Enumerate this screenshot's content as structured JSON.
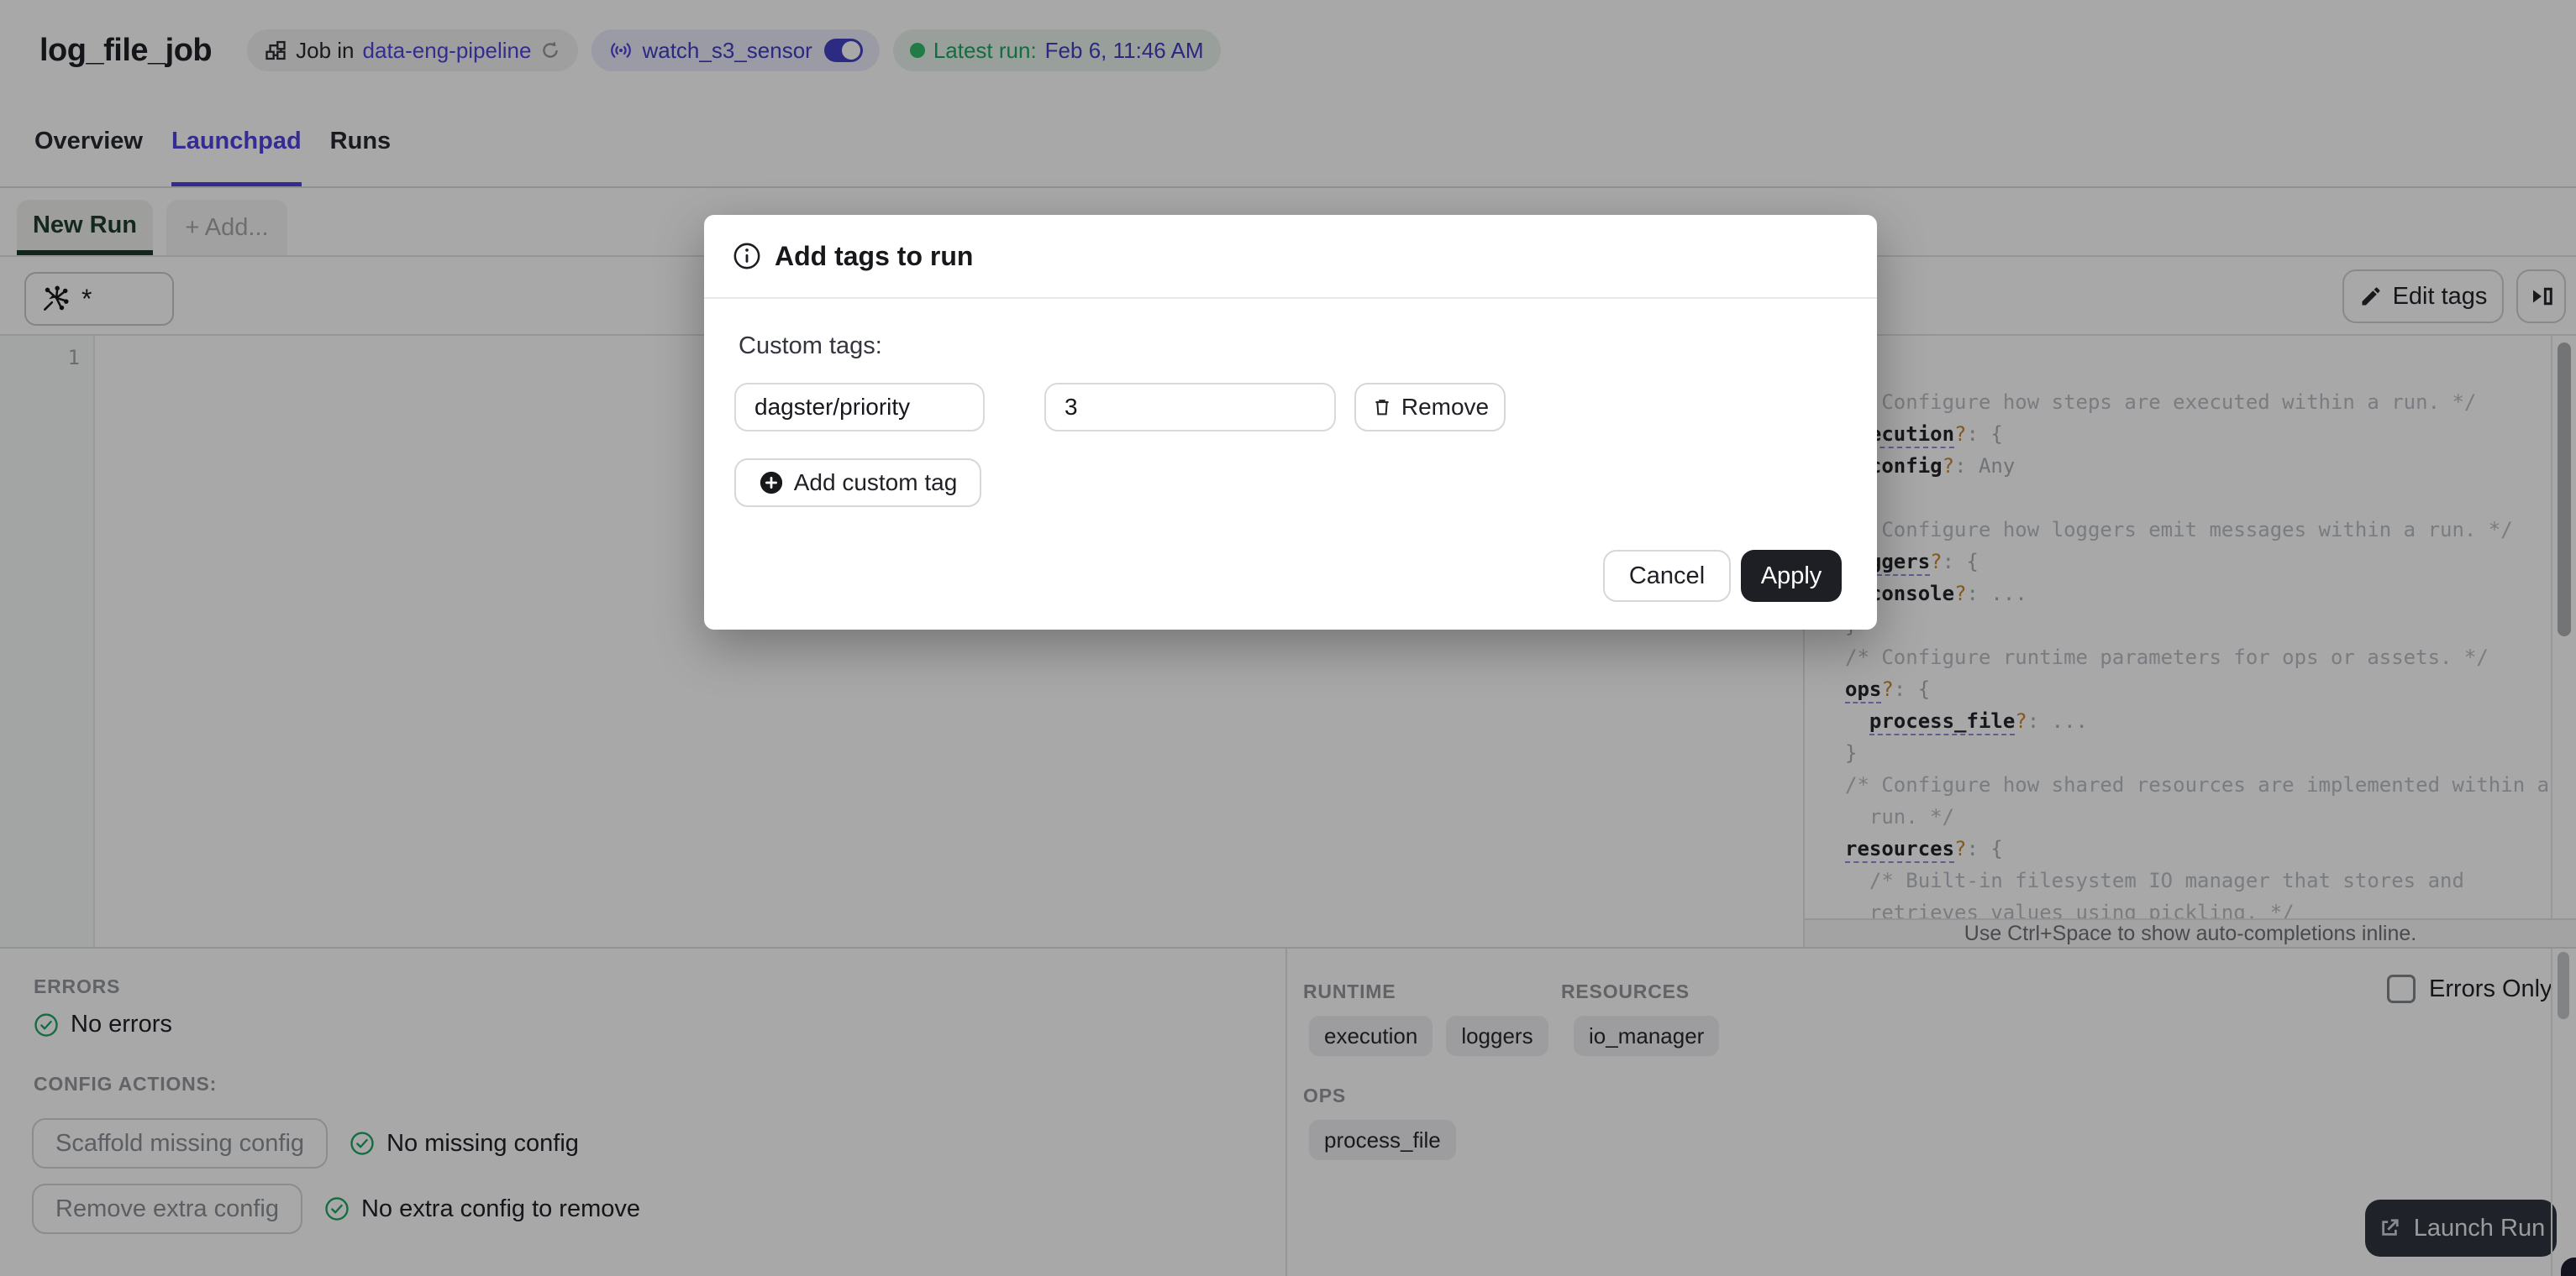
{
  "colors": {
    "accent_blurple": "#4F43DD",
    "link_navy": "#423DBF",
    "status_green": "#1FA463",
    "newrun_tab_underline": "#1C3A2E",
    "launch_button_bg": "#30343D",
    "apply_button_bg": "#1E1F24",
    "qmark_orange": "#C9862F"
  },
  "header": {
    "title": "log_file_job",
    "job_badge": {
      "prefix": "Job in",
      "link": "data-eng-pipeline"
    },
    "sensor_badge": {
      "label": "watch_s3_sensor",
      "state": "on"
    },
    "latest_run_badge": {
      "label": "Latest run:",
      "value": "Feb 6, 11:46 AM"
    }
  },
  "tabs": [
    {
      "label": "Overview",
      "active": false
    },
    {
      "label": "Launchpad",
      "active": true
    },
    {
      "label": "Runs",
      "active": false
    }
  ],
  "launchpad": {
    "run_tab_label": "New Run",
    "add_tab_label": "+ Add...",
    "op_selector_value": "*",
    "edit_tags_label": "Edit tags",
    "editor_line_number": "1"
  },
  "schema_panel": {
    "hint": "Use Ctrl+Space to show auto-completions inline.",
    "lines": [
      [
        {
          "t": "/* Configure how steps are executed within a run. */",
          "s": "c"
        }
      ],
      [
        {
          "t": "execution",
          "s": "k",
          "u": true
        },
        {
          "t": "?",
          "s": "q"
        },
        {
          "t": ": {",
          "s": "p"
        }
      ],
      [
        {
          "t": "  ",
          "s": "p"
        },
        {
          "t": "config",
          "s": "k"
        },
        {
          "t": "?",
          "s": "q"
        },
        {
          "t": ": Any",
          "s": "p"
        }
      ],
      [
        {
          "t": "}",
          "s": "p"
        }
      ],
      [
        {
          "t": "/* Configure how loggers emit messages within a run. */",
          "s": "c"
        }
      ],
      [
        {
          "t": "loggers",
          "s": "k",
          "u": true
        },
        {
          "t": "?",
          "s": "q"
        },
        {
          "t": ": {",
          "s": "p"
        }
      ],
      [
        {
          "t": "  ",
          "s": "p"
        },
        {
          "t": "console",
          "s": "k"
        },
        {
          "t": "?",
          "s": "q"
        },
        {
          "t": ": ...",
          "s": "p"
        }
      ],
      [
        {
          "t": "}",
          "s": "p"
        }
      ],
      [
        {
          "t": "/* Configure runtime parameters for ops or assets. */",
          "s": "c"
        }
      ],
      [
        {
          "t": "ops",
          "s": "k",
          "u": true
        },
        {
          "t": "?",
          "s": "q"
        },
        {
          "t": ": {",
          "s": "p"
        }
      ],
      [
        {
          "t": "  ",
          "s": "p"
        },
        {
          "t": "process_file",
          "s": "k",
          "u": true
        },
        {
          "t": "?",
          "s": "q"
        },
        {
          "t": ": ...",
          "s": "p"
        }
      ],
      [
        {
          "t": "}",
          "s": "p"
        }
      ],
      [
        {
          "t": "/* Configure how shared resources are implemented within a",
          "s": "c"
        }
      ],
      [
        {
          "t": "  run. */",
          "s": "c"
        }
      ],
      [
        {
          "t": "resources",
          "s": "k",
          "u": true
        },
        {
          "t": "?",
          "s": "q"
        },
        {
          "t": ": {",
          "s": "p"
        }
      ],
      [
        {
          "t": "  /* Built-in filesystem IO manager that stores and",
          "s": "c"
        }
      ],
      [
        {
          "t": "  retrieves values using pickling. */",
          "s": "c"
        }
      ]
    ]
  },
  "modal": {
    "title": "Add tags to run",
    "custom_tags_label": "Custom tags:",
    "tag_key": "dagster/priority",
    "tag_value": "3",
    "remove_label": "Remove",
    "add_custom_tag_label": "Add custom tag",
    "cancel_label": "Cancel",
    "apply_label": "Apply"
  },
  "bottom_left": {
    "errors_header": "ERRORS",
    "no_errors": "No errors",
    "config_actions_header": "CONFIG ACTIONS:",
    "scaffold_label": "Scaffold missing config",
    "no_missing": "No missing config",
    "remove_label": "Remove extra config",
    "no_extra": "No extra config to remove"
  },
  "bottom_right": {
    "runtime_header": "RUNTIME",
    "resources_header": "RESOURCES",
    "ops_header": "OPS",
    "runtime_tags": [
      "execution",
      "loggers"
    ],
    "resources_tags": [
      "io_manager"
    ],
    "ops_tags": [
      "process_file"
    ],
    "errors_only_label": "Errors Only"
  },
  "launch": {
    "label": "Launch Run"
  }
}
